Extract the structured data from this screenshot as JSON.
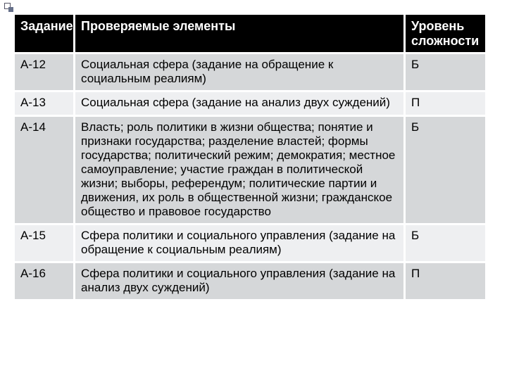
{
  "table": {
    "headers": {
      "task": "Задание",
      "elements": "Проверяемые элементы",
      "level": "Уровень сложности"
    },
    "rows": [
      {
        "task": "А-12",
        "elements": "Социальная сфера (задание на обращение к социальным реалиям)",
        "level": "Б"
      },
      {
        "task": "А-13",
        "elements": "Социальная сфера (задание на анализ двух суждений)",
        "level": "П"
      },
      {
        "task": "А-14",
        "elements": "Власть; роль политики в жизни общества; понятие и признаки государства; разделение властей; формы государства; политический режим; демократия; местное самоуправление; участие граждан в политической жизни; выборы, референдум; политические партии и движения, их роль в общественной жизни; гражданское общество и правовое государство",
        "level": "Б"
      },
      {
        "task": "А-15",
        "elements": "Сфера политики и социального управления (задание на обращение к социальным реалиям)",
        "level": "Б"
      },
      {
        "task": "А-16",
        "elements": "Сфера политики и социального управления (задание на анализ двух суждений)",
        "level": "П"
      }
    ]
  }
}
